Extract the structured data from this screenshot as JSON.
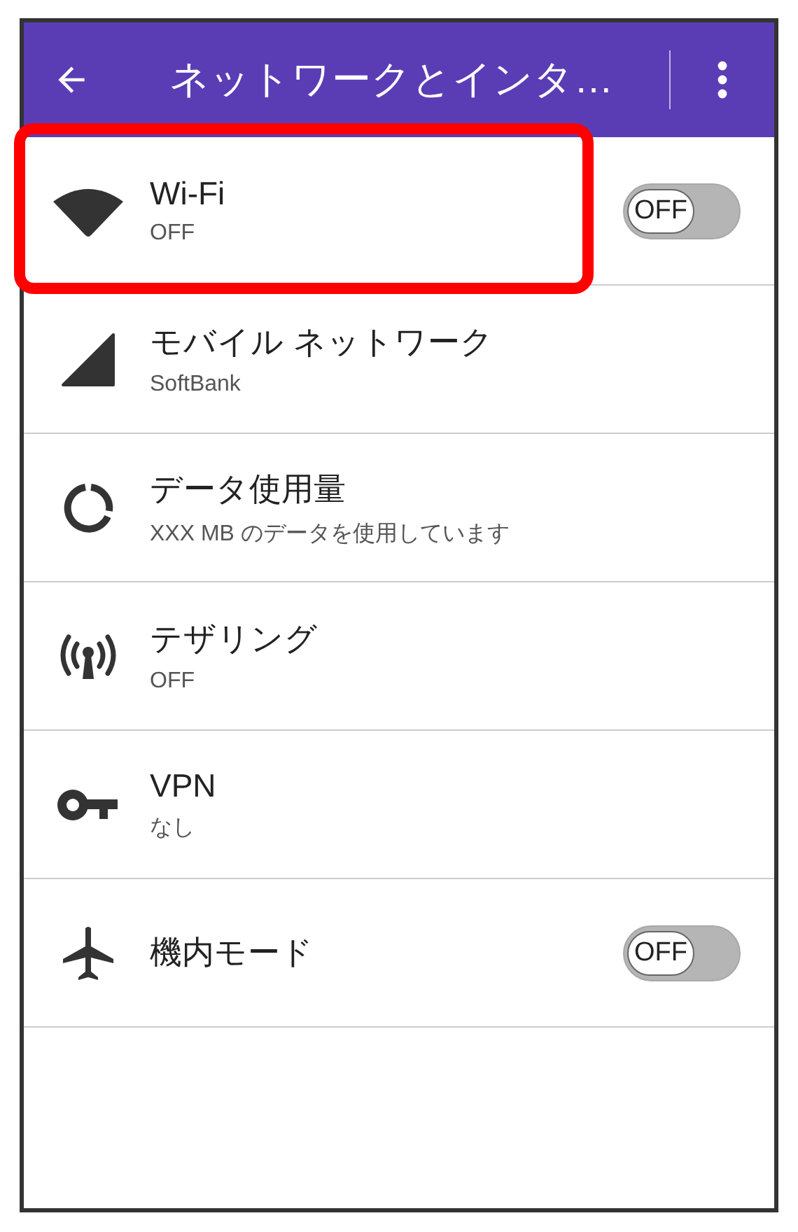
{
  "app_bar": {
    "title": "ネットワークとインタ…"
  },
  "items": [
    {
      "kind": "switch",
      "title": "Wi-Fi",
      "subtitle": "OFF",
      "on": false,
      "toggle_label": "OFF",
      "highlighted": true
    },
    {
      "kind": "plain",
      "title": "モバイル ネットワーク",
      "subtitle": "SoftBank",
      "highlighted": false
    },
    {
      "kind": "plain",
      "title": "データ使用量",
      "subtitle": "XXX MB のデータを使用しています",
      "highlighted": false
    },
    {
      "kind": "plain",
      "title": "テザリング",
      "subtitle": "OFF",
      "highlighted": false
    },
    {
      "kind": "plain",
      "title": "VPN",
      "subtitle": "なし",
      "highlighted": false
    },
    {
      "kind": "switch",
      "title": "機内モード",
      "on": false,
      "toggle_label": "OFF",
      "highlighted": false
    }
  ]
}
